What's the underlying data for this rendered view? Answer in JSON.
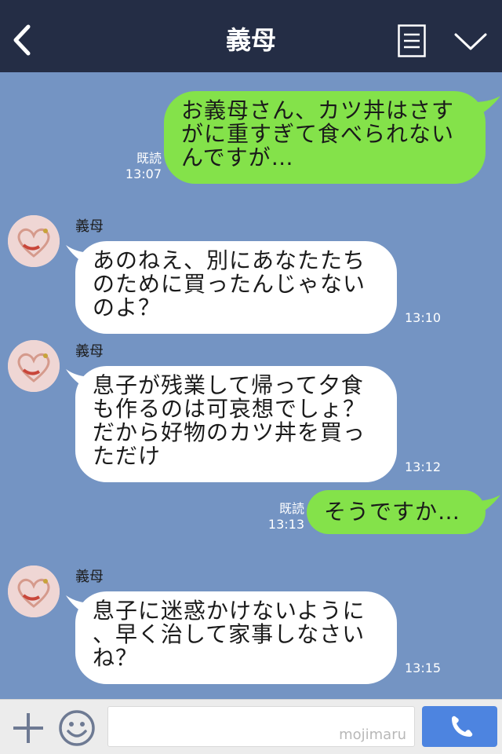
{
  "header": {
    "title": "義母",
    "back_icon": "chevron-left-icon",
    "menu_icon": "list-menu-icon",
    "collapse_icon": "chevron-down-icon"
  },
  "messages": [
    {
      "sender": "me",
      "text": "お義母さん、カツ丼はさす\nがに重すぎて食べられない\nんですが…",
      "read": "既読",
      "time": "13:07"
    },
    {
      "sender": "them",
      "name": "義母",
      "text": "あのねえ、別にあなたたち\nのために買ったんじゃない\nのよ？",
      "time": "13:10"
    },
    {
      "sender": "them",
      "name": "義母",
      "text": "息子が残業して帰って夕食\nも作るのは可哀想でしょ？\nだから好物のカツ丼を買っ\nただけ",
      "time": "13:12"
    },
    {
      "sender": "me",
      "text": "そうですか…",
      "read": "既読",
      "time": "13:13"
    },
    {
      "sender": "them",
      "name": "義母",
      "text": "息子に迷惑かけないように\n、早く治して家事しなさい\nね？",
      "time": "13:15"
    }
  ],
  "footer": {
    "input_placeholder": "",
    "watermark": "mojimaru",
    "plus_icon": "plus-icon",
    "emoji_icon": "smiley-icon",
    "call_icon": "phone-icon"
  },
  "colors": {
    "header_bg": "#242d45",
    "chat_bg": "#7494c3",
    "my_bubble": "#84e24a",
    "their_bubble": "#ffffff",
    "call_button": "#4d84e0"
  }
}
